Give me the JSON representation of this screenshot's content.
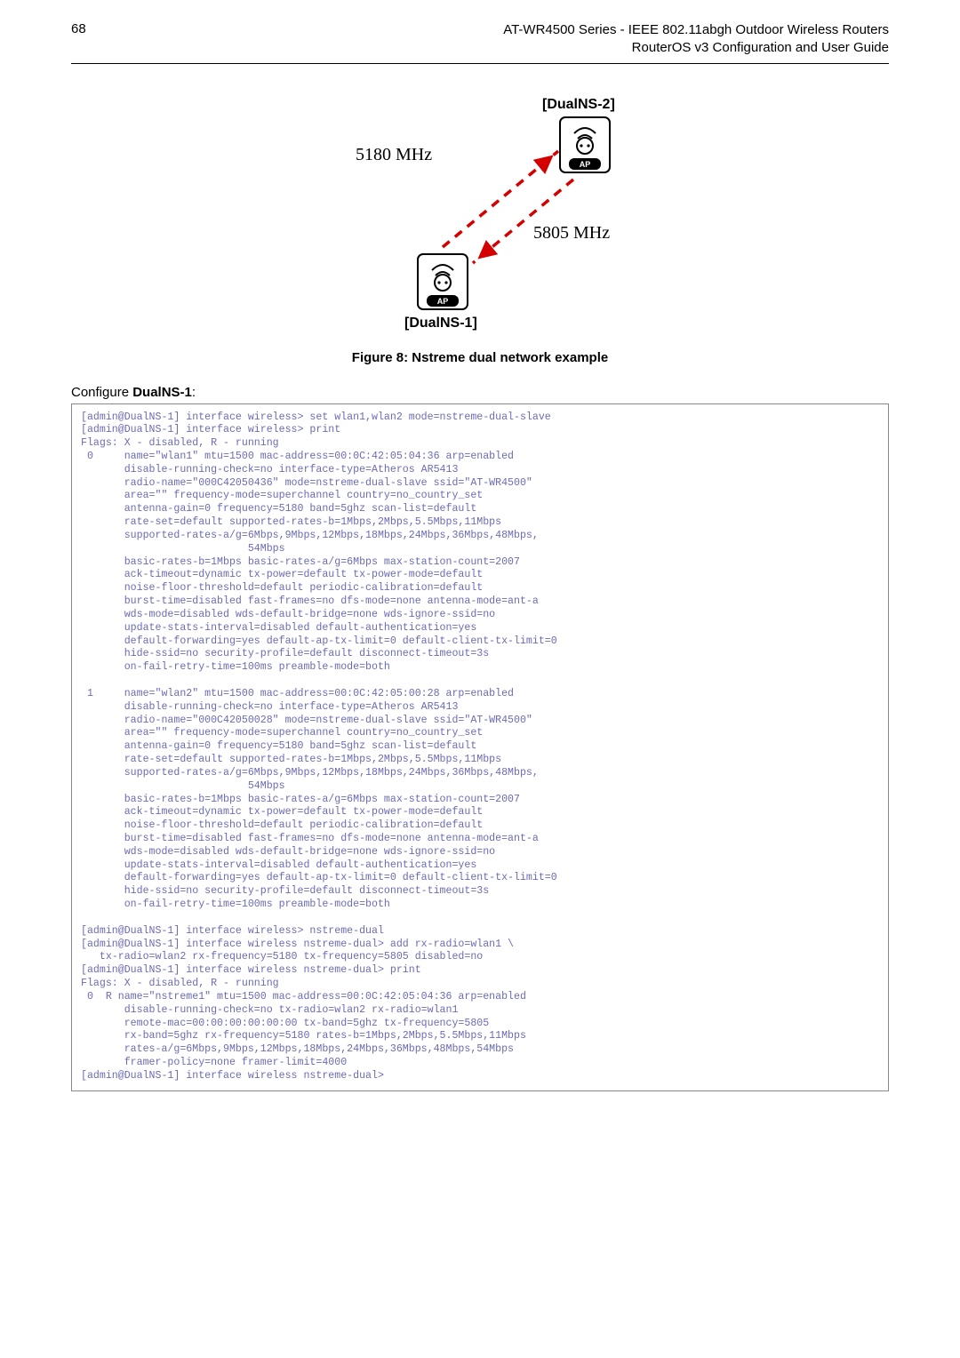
{
  "page_number": "68",
  "header_line1": "AT-WR4500 Series - IEEE 802.11abgh Outdoor Wireless Routers",
  "header_line2": "RouterOS v3 Configuration and User Guide",
  "figure": {
    "label_top": "[DualNS-2]",
    "label_bottom": "[DualNS-1]",
    "freq_left": "5180 MHz",
    "freq_right": "5805 MHz",
    "ap_badge": "AP"
  },
  "figure_caption": "Figure 8: Nstreme dual network example",
  "configure_prefix": "Configure ",
  "configure_bold": "DualNS-1",
  "configure_suffix": ":",
  "code_text": "[admin@DualNS-1] interface wireless> set wlan1,wlan2 mode=nstreme-dual-slave\n[admin@DualNS-1] interface wireless> print\nFlags: X - disabled, R - running\n 0     name=\"wlan1\" mtu=1500 mac-address=00:0C:42:05:04:36 arp=enabled\n       disable-running-check=no interface-type=Atheros AR5413\n       radio-name=\"000C42050436\" mode=nstreme-dual-slave ssid=\"AT-WR4500\"\n       area=\"\" frequency-mode=superchannel country=no_country_set\n       antenna-gain=0 frequency=5180 band=5ghz scan-list=default\n       rate-set=default supported-rates-b=1Mbps,2Mbps,5.5Mbps,11Mbps\n       supported-rates-a/g=6Mbps,9Mbps,12Mbps,18Mbps,24Mbps,36Mbps,48Mbps,\n                           54Mbps\n       basic-rates-b=1Mbps basic-rates-a/g=6Mbps max-station-count=2007\n       ack-timeout=dynamic tx-power=default tx-power-mode=default\n       noise-floor-threshold=default periodic-calibration=default\n       burst-time=disabled fast-frames=no dfs-mode=none antenna-mode=ant-a\n       wds-mode=disabled wds-default-bridge=none wds-ignore-ssid=no\n       update-stats-interval=disabled default-authentication=yes\n       default-forwarding=yes default-ap-tx-limit=0 default-client-tx-limit=0\n       hide-ssid=no security-profile=default disconnect-timeout=3s\n       on-fail-retry-time=100ms preamble-mode=both\n\n 1     name=\"wlan2\" mtu=1500 mac-address=00:0C:42:05:00:28 arp=enabled\n       disable-running-check=no interface-type=Atheros AR5413\n       radio-name=\"000C42050028\" mode=nstreme-dual-slave ssid=\"AT-WR4500\"\n       area=\"\" frequency-mode=superchannel country=no_country_set\n       antenna-gain=0 frequency=5180 band=5ghz scan-list=default\n       rate-set=default supported-rates-b=1Mbps,2Mbps,5.5Mbps,11Mbps\n       supported-rates-a/g=6Mbps,9Mbps,12Mbps,18Mbps,24Mbps,36Mbps,48Mbps,\n                           54Mbps\n       basic-rates-b=1Mbps basic-rates-a/g=6Mbps max-station-count=2007\n       ack-timeout=dynamic tx-power=default tx-power-mode=default\n       noise-floor-threshold=default periodic-calibration=default\n       burst-time=disabled fast-frames=no dfs-mode=none antenna-mode=ant-a\n       wds-mode=disabled wds-default-bridge=none wds-ignore-ssid=no\n       update-stats-interval=disabled default-authentication=yes\n       default-forwarding=yes default-ap-tx-limit=0 default-client-tx-limit=0\n       hide-ssid=no security-profile=default disconnect-timeout=3s\n       on-fail-retry-time=100ms preamble-mode=both\n\n[admin@DualNS-1] interface wireless> nstreme-dual\n[admin@DualNS-1] interface wireless nstreme-dual> add rx-radio=wlan1 \\\n   tx-radio=wlan2 rx-frequency=5180 tx-frequency=5805 disabled=no\n[admin@DualNS-1] interface wireless nstreme-dual> print\nFlags: X - disabled, R - running\n 0  R name=\"nstreme1\" mtu=1500 mac-address=00:0C:42:05:04:36 arp=enabled\n       disable-running-check=no tx-radio=wlan2 rx-radio=wlan1\n       remote-mac=00:00:00:00:00:00 tx-band=5ghz tx-frequency=5805\n       rx-band=5ghz rx-frequency=5180 rates-b=1Mbps,2Mbps,5.5Mbps,11Mbps\n       rates-a/g=6Mbps,9Mbps,12Mbps,18Mbps,24Mbps,36Mbps,48Mbps,54Mbps\n       framer-policy=none framer-limit=4000\n[admin@DualNS-1] interface wireless nstreme-dual>"
}
